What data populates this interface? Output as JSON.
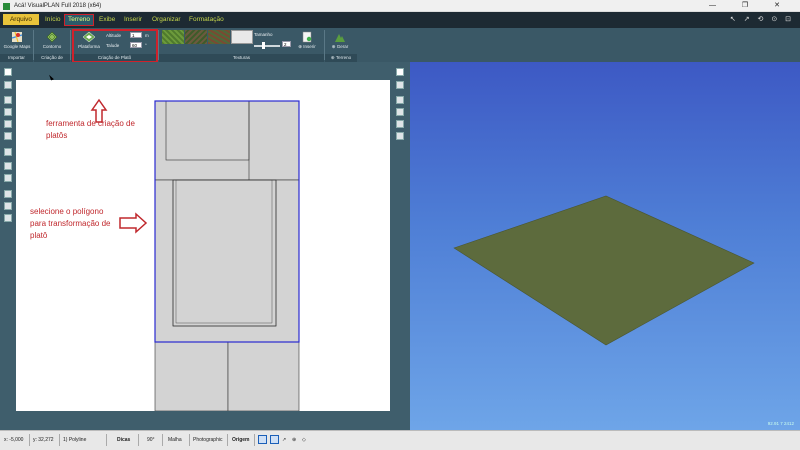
{
  "window": {
    "title": "Acá! VisualPLAN Full 2018 (x64)",
    "controls": [
      "—",
      "❐",
      "✕"
    ]
  },
  "menu": {
    "file": "Arquivo",
    "items": [
      "Início",
      "Terreno",
      "Exibe",
      "Inserir",
      "Organizar",
      "Formatação"
    ],
    "active_index": 1,
    "quick_icons": "↖ ↗ ⟲ ⊙ ⊡"
  },
  "ribbon": {
    "buttons": {
      "google_maps": "Google Maps",
      "contorno": "Contorno",
      "platform": "Plataforma",
      "inserir": "⊕ Inserir",
      "gerar": "⊕ Gerar"
    },
    "fields": {
      "altitude_label": "Altitude",
      "altitude_value": "1",
      "altitude_unit": "m",
      "talude_label": "Talude",
      "talude_value": "60",
      "talude_unit": "°",
      "tamanho_label": "Tamanho",
      "tamanho_value": "2"
    },
    "groups": {
      "importar": "Importar",
      "criacao_modelo": "Criação de Modelo",
      "criacao_plato": "Criação de Platô",
      "texturas": "Texturas",
      "terreno": "⊕ Terreno"
    }
  },
  "annotations": {
    "tool_note": "ferramenta de criação de platôs",
    "select_note": "selecione o polígono para transformação de platô"
  },
  "view3d": {
    "readout": "92.91   7   2412",
    "terrain_color": "#5d6b3d"
  },
  "status": {
    "x": "x: -5,000",
    "y": "y: 32,272",
    "layer": "1) Polyline",
    "dicas": "Dicas",
    "angle": "90°",
    "malha": "Malha",
    "photographic": "Photographic",
    "origem": "Origem"
  },
  "colors": {
    "menubar": "#1d2a33",
    "menu_text": "#c7d64b",
    "ribbon": "#3a5866",
    "highlight": "#d0212b",
    "annotation": "#c0282d",
    "selection_polygon": "#2a2ad0"
  }
}
